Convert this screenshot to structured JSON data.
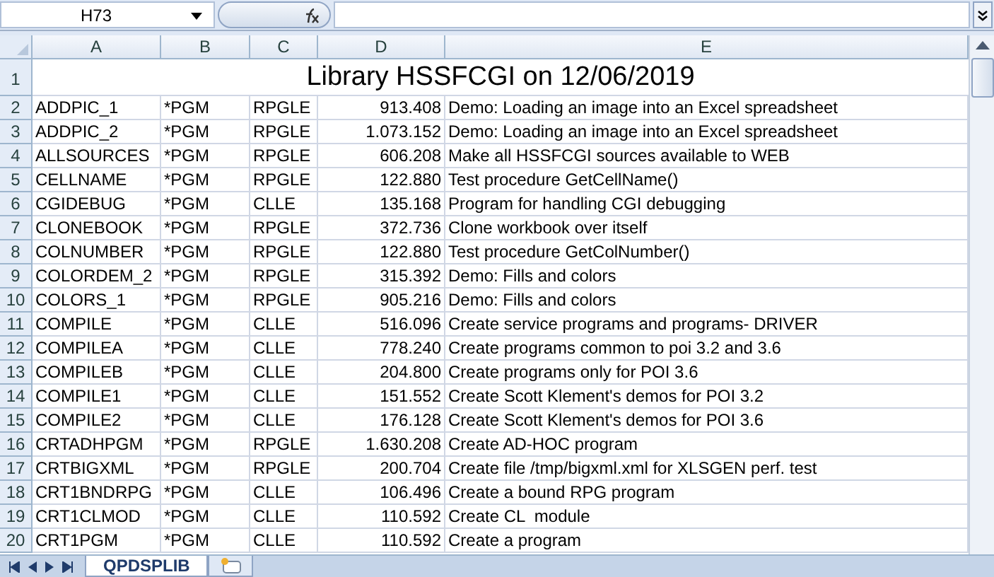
{
  "formula_bar": {
    "name_box": "H73"
  },
  "sheet": {
    "columns": [
      "A",
      "B",
      "C",
      "D",
      "E"
    ],
    "title_row": {
      "row_number": "1",
      "text": "Library HSSFCGI on 12/06/2019"
    },
    "rows": [
      {
        "row_number": "2",
        "cells": [
          "ADDPIC_1",
          "*PGM",
          "RPGLE",
          "913.408",
          "Demo: Loading an image into an Excel spreadsheet"
        ]
      },
      {
        "row_number": "3",
        "cells": [
          "ADDPIC_2",
          "*PGM",
          "RPGLE",
          "1.073.152",
          "Demo: Loading an image into an Excel spreadsheet"
        ]
      },
      {
        "row_number": "4",
        "cells": [
          "ALLSOURCES",
          "*PGM",
          "RPGLE",
          "606.208",
          "Make all HSSFCGI sources available to WEB"
        ]
      },
      {
        "row_number": "5",
        "cells": [
          "CELLNAME",
          "*PGM",
          "RPGLE",
          "122.880",
          "Test procedure GetCellName()"
        ]
      },
      {
        "row_number": "6",
        "cells": [
          "CGIDEBUG",
          "*PGM",
          "CLLE",
          "135.168",
          "Program for handling CGI debugging"
        ]
      },
      {
        "row_number": "7",
        "cells": [
          "CLONEBOOK",
          "*PGM",
          "RPGLE",
          "372.736",
          "Clone workbook over itself"
        ]
      },
      {
        "row_number": "8",
        "cells": [
          "COLNUMBER",
          "*PGM",
          "RPGLE",
          "122.880",
          "Test procedure GetColNumber()"
        ]
      },
      {
        "row_number": "9",
        "cells": [
          "COLORDEM_2",
          "*PGM",
          "RPGLE",
          "315.392",
          "Demo: Fills and colors"
        ]
      },
      {
        "row_number": "10",
        "cells": [
          "COLORS_1",
          "*PGM",
          "RPGLE",
          "905.216",
          "Demo: Fills and colors"
        ]
      },
      {
        "row_number": "11",
        "cells": [
          "COMPILE",
          "*PGM",
          "CLLE",
          "516.096",
          "Create service programs and programs- DRIVER"
        ]
      },
      {
        "row_number": "12",
        "cells": [
          "COMPILEA",
          "*PGM",
          "CLLE",
          "778.240",
          "Create programs common to poi 3.2 and 3.6"
        ]
      },
      {
        "row_number": "13",
        "cells": [
          "COMPILEB",
          "*PGM",
          "CLLE",
          "204.800",
          "Create programs only for POI 3.6"
        ]
      },
      {
        "row_number": "14",
        "cells": [
          "COMPILE1",
          "*PGM",
          "CLLE",
          "151.552",
          "Create Scott Klement's demos for POI 3.2"
        ]
      },
      {
        "row_number": "15",
        "cells": [
          "COMPILE2",
          "*PGM",
          "CLLE",
          "176.128",
          "Create Scott Klement's demos for POI 3.6"
        ]
      },
      {
        "row_number": "16",
        "cells": [
          "CRTADHPGM",
          "*PGM",
          "RPGLE",
          "1.630.208",
          "Create AD-HOC program"
        ]
      },
      {
        "row_number": "17",
        "cells": [
          "CRTBIGXML",
          "*PGM",
          "RPGLE",
          "200.704",
          "Create file /tmp/bigxml.xml for XLSGEN perf. test"
        ]
      },
      {
        "row_number": "18",
        "cells": [
          "CRT1BNDRPG",
          "*PGM",
          "CLLE",
          "106.496",
          "Create a bound RPG program"
        ]
      },
      {
        "row_number": "19",
        "cells": [
          "CRT1CLMOD",
          "*PGM",
          "CLLE",
          "110.592",
          "Create CL  module"
        ]
      },
      {
        "row_number": "20",
        "cells": [
          "CRT1PGM",
          "*PGM",
          "CLLE",
          "110.592",
          "Create a program"
        ]
      }
    ]
  },
  "sheet_tabs": [
    {
      "label": "QPDSPLIB",
      "selected": true
    }
  ]
}
